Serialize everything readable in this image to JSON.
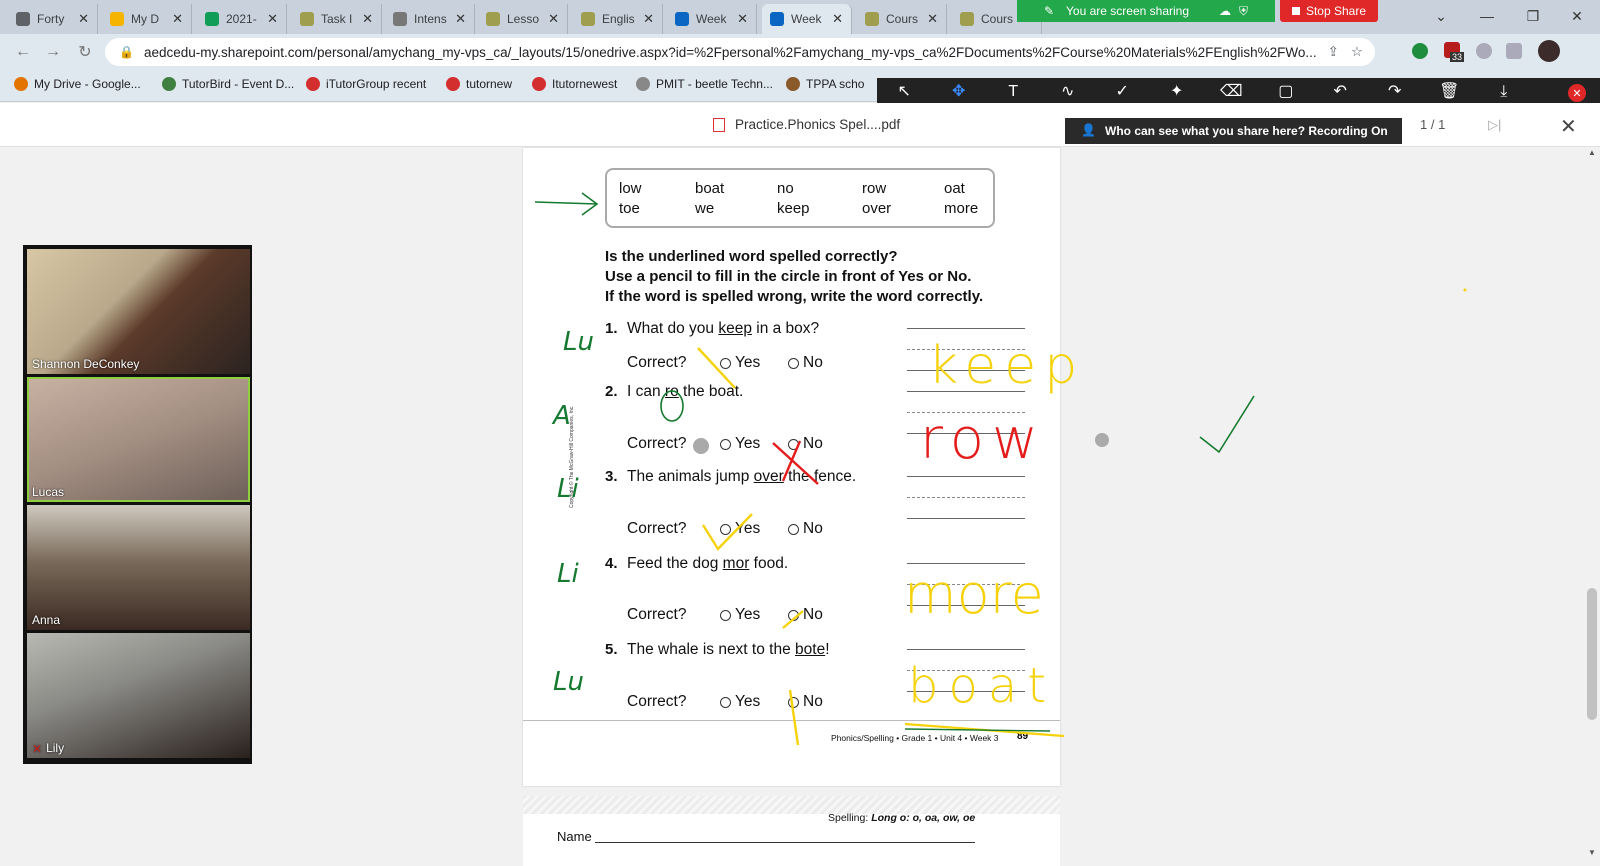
{
  "tabs": [
    {
      "label": "Forty",
      "color": "#5f6368"
    },
    {
      "label": "My D",
      "color": "#f4b400"
    },
    {
      "label": "2021-",
      "color": "#0f9d58"
    },
    {
      "label": "Task I",
      "color": "#9e9e4e"
    },
    {
      "label": "Intens",
      "color": "#777777"
    },
    {
      "label": "Lesso",
      "color": "#9e9e4e"
    },
    {
      "label": "Englis",
      "color": "#9e9e4e"
    },
    {
      "label": "Week",
      "color": "#0a66c2"
    },
    {
      "label": "Week",
      "color": "#0a66c2"
    },
    {
      "label": "Cours",
      "color": "#9e9e4e"
    },
    {
      "label": "Cours",
      "color": "#9e9e4e"
    }
  ],
  "window_controls": {
    "chevron": "⌄",
    "minimize": "—",
    "restore": "❐",
    "close": "✕"
  },
  "address_bar": {
    "url": "aedcedu-my.sharepoint.com/personal/amychang_my-vps_ca/_layouts/15/onedrive.aspx?id=%2Fpersonal%2Famychang_my-vps_ca%2FDocuments%2FCourse%20Materials%2FEnglish%2FWo..."
  },
  "extension_badge": "33",
  "bookmarks": [
    {
      "label": "My Drive - Google...",
      "color": "#e37400"
    },
    {
      "label": "TutorBird - Event D...",
      "color": "#3f7f3f"
    },
    {
      "label": "iTutorGroup recent",
      "color": "#d32f2f"
    },
    {
      "label": "tutornew",
      "color": "#d32f2f"
    },
    {
      "label": "Itutornewest",
      "color": "#d32f2f"
    },
    {
      "label": "PMIT - beetle Techn...",
      "color": "#888888"
    },
    {
      "label": "TPPA scho",
      "color": "#8a5a2b"
    }
  ],
  "zoom": {
    "sharing_banner": "You are screen sharing",
    "stop_share": "Stop Share",
    "who_can_see": "Who can see what you share here? Recording On",
    "tools": [
      {
        "label": "Mouse",
        "icon": "cursor-icon",
        "glyph": "↖"
      },
      {
        "label": "Select",
        "icon": "select-icon",
        "glyph": "✥"
      },
      {
        "label": "Text",
        "icon": "text-icon",
        "glyph": "T"
      },
      {
        "label": "Draw",
        "icon": "draw-icon",
        "glyph": "∿"
      },
      {
        "label": "Stamp",
        "icon": "stamp-icon",
        "glyph": "✓"
      },
      {
        "label": "Spotlight",
        "icon": "spotlight-icon",
        "glyph": "✦"
      },
      {
        "label": "Eraser",
        "icon": "eraser-icon",
        "glyph": "⌫"
      },
      {
        "label": "Format",
        "icon": "format-icon",
        "glyph": "▢"
      },
      {
        "label": "Undo",
        "icon": "undo-icon",
        "glyph": "↶"
      },
      {
        "label": "Redo",
        "icon": "redo-icon",
        "glyph": "↷"
      },
      {
        "label": "Clear",
        "icon": "trash-icon",
        "glyph": "🗑"
      },
      {
        "label": "Save",
        "icon": "save-icon",
        "glyph": "⤓"
      }
    ],
    "selected_tool": "Select"
  },
  "viewer": {
    "doc_name": "Practice.Phonics Spel....pdf",
    "page_count": "1 / 1"
  },
  "worksheet": {
    "words": [
      [
        "low",
        "toe"
      ],
      [
        "boat",
        "we"
      ],
      [
        "no",
        "keep"
      ],
      [
        "row",
        "over"
      ],
      [
        "oat",
        "more"
      ]
    ],
    "instructions": [
      "Is the underlined word spelled correctly?",
      "Use a pencil to fill in the circle in front of Yes or No.",
      "If the word is spelled wrong, write the word correctly."
    ],
    "questions": [
      {
        "num": "1.",
        "pre": "What do you ",
        "underlined": "keep",
        "post": " in a box?"
      },
      {
        "num": "2.",
        "pre": "I can ",
        "underlined": "ro",
        "post": " the boat."
      },
      {
        "num": "3.",
        "pre": "The animals jump ",
        "underlined": "over",
        "post": " the fence."
      },
      {
        "num": "4.",
        "pre": "Feed the dog ",
        "underlined": "mor",
        "post": " food."
      },
      {
        "num": "5.",
        "pre": "The whale is next to the ",
        "underlined": "bote",
        "post": "!"
      }
    ],
    "correct_label": "Correct?",
    "yes_label": "Yes",
    "no_label": "No",
    "footer": "Phonics/Spelling • Grade 1 • Unit 4 • Week 3",
    "page_number": "89",
    "copyright": "Copyright © The McGraw-Hill Companies, Inc.",
    "next_page_heading_label": "Spelling:",
    "next_page_heading": "Long o: o, oa, ow, oe",
    "next_page_name_label": "Name"
  },
  "annotations": {
    "student_initials": [
      "Lu",
      "A",
      "Li",
      "Li",
      "Lu"
    ],
    "handwritten_answers": [
      "keep",
      "row",
      "more",
      "boat"
    ],
    "colors": {
      "yellow": "#f5d20a",
      "red": "#e51c1c",
      "green": "#157a2f"
    }
  },
  "participants": [
    {
      "name": "Shannon DeConkey",
      "active": false
    },
    {
      "name": "Lucas",
      "active": true
    },
    {
      "name": "Anna",
      "active": false
    },
    {
      "name": "Lily",
      "active": false,
      "muted": true
    }
  ]
}
